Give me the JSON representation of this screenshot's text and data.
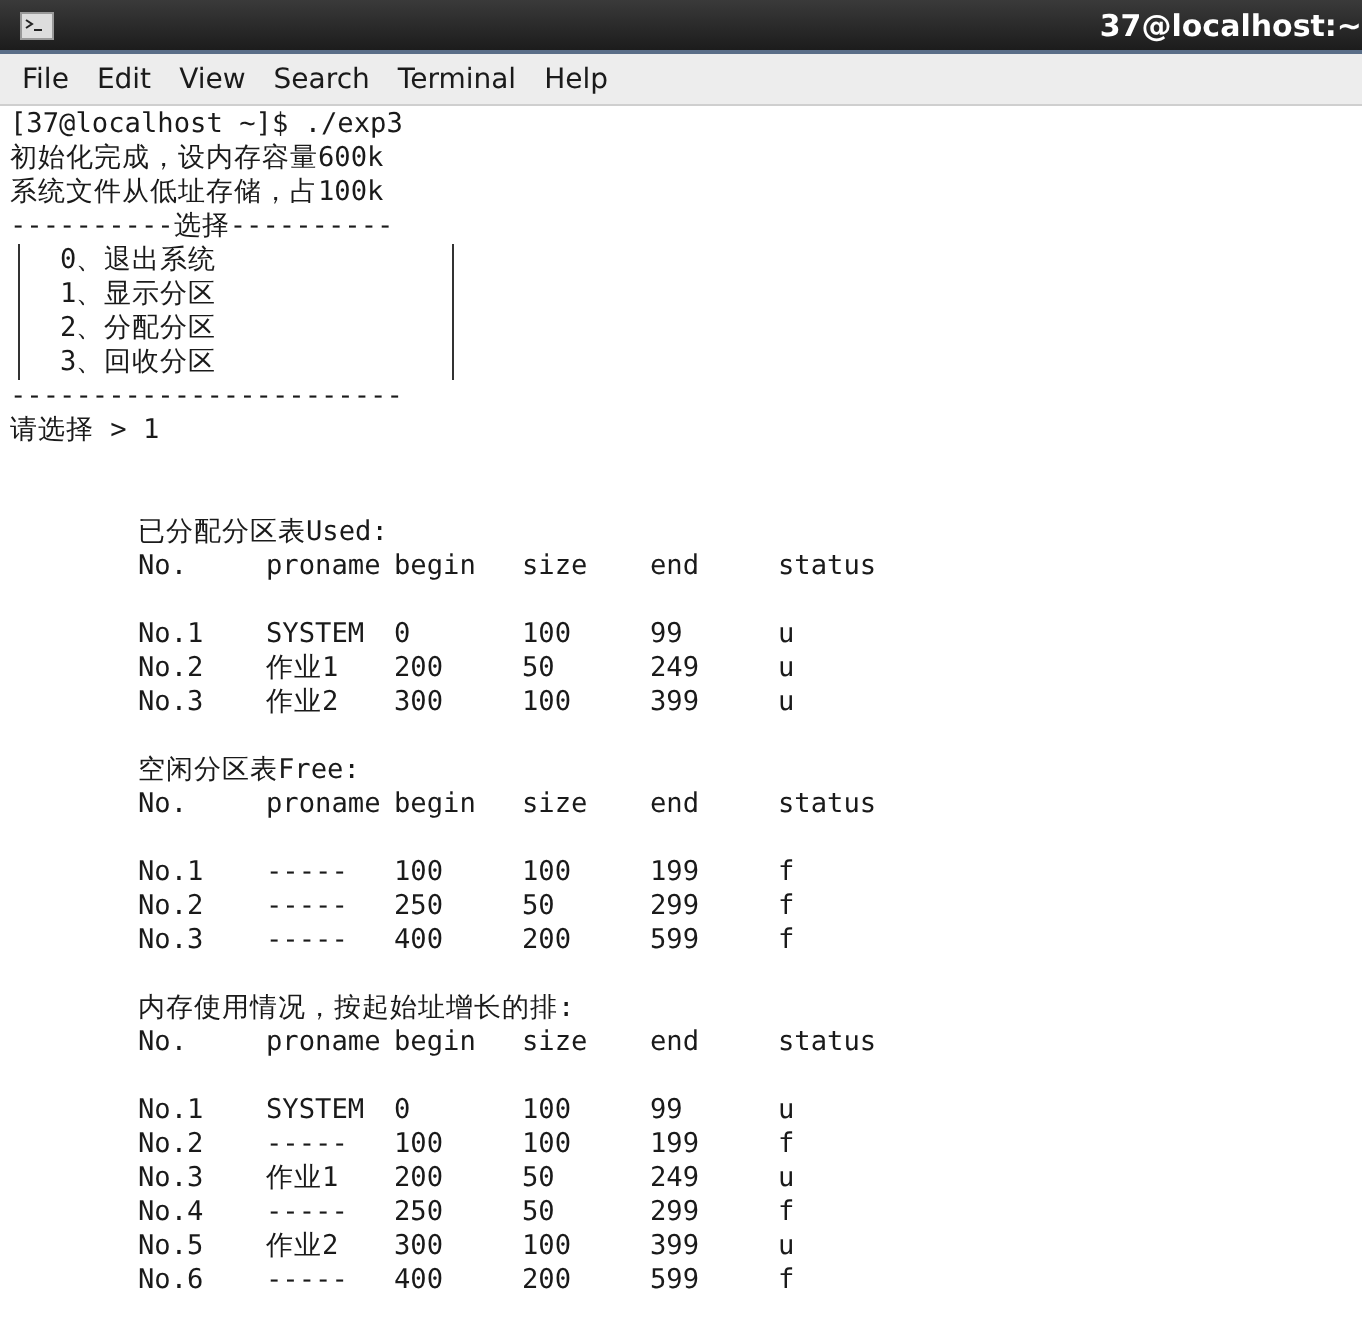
{
  "window": {
    "title": "37@localhost:~"
  },
  "menu": [
    "File",
    "Edit",
    "View",
    "Search",
    "Terminal",
    "Help"
  ],
  "terminal": {
    "intro": [
      "[37@localhost ~]$ ./exp3",
      "初始化完成，设内存容量600k",
      "系统文件从低址存储，占100k"
    ],
    "menu_box": {
      "top": "----------选择----------",
      "items": [
        "0、退出系统",
        "1、显示分区",
        "2、分配分区",
        "3、回收分区"
      ],
      "bottom": "------------------------"
    },
    "prompt": "请选择 > 1",
    "tables": [
      {
        "title": "已分配分区表Used:",
        "columns": [
          "No.",
          "proname",
          "begin",
          "size",
          "end",
          "status"
        ],
        "rows": [
          [
            "No.1",
            "SYSTEM",
            "0",
            "100",
            "99",
            "u"
          ],
          [
            "No.2",
            "作业1",
            "200",
            "50",
            "249",
            "u"
          ],
          [
            "No.3",
            "作业2",
            "300",
            "100",
            "399",
            "u"
          ]
        ]
      },
      {
        "title": "空闲分区表Free:",
        "columns": [
          "No.",
          "proname",
          "begin",
          "size",
          "end",
          "status"
        ],
        "rows": [
          [
            "No.1",
            "-----",
            "100",
            "100",
            "199",
            "f"
          ],
          [
            "No.2",
            "-----",
            "250",
            "50",
            "299",
            "f"
          ],
          [
            "No.3",
            "-----",
            "400",
            "200",
            "599",
            "f"
          ]
        ]
      },
      {
        "title": "内存使用情况，按起始址增长的排:",
        "columns": [
          "No.",
          "proname",
          "begin",
          "size",
          "end",
          "status"
        ],
        "rows": [
          [
            "No.1",
            "SYSTEM",
            "0",
            "100",
            "99",
            "u"
          ],
          [
            "No.2",
            "-----",
            "100",
            "100",
            "199",
            "f"
          ],
          [
            "No.3",
            "作业1",
            "200",
            "50",
            "249",
            "u"
          ],
          [
            "No.4",
            "-----",
            "250",
            "50",
            "299",
            "f"
          ],
          [
            "No.5",
            "作业2",
            "300",
            "100",
            "399",
            "u"
          ],
          [
            "No.6",
            "-----",
            "400",
            "200",
            "599",
            "f"
          ]
        ]
      }
    ]
  }
}
